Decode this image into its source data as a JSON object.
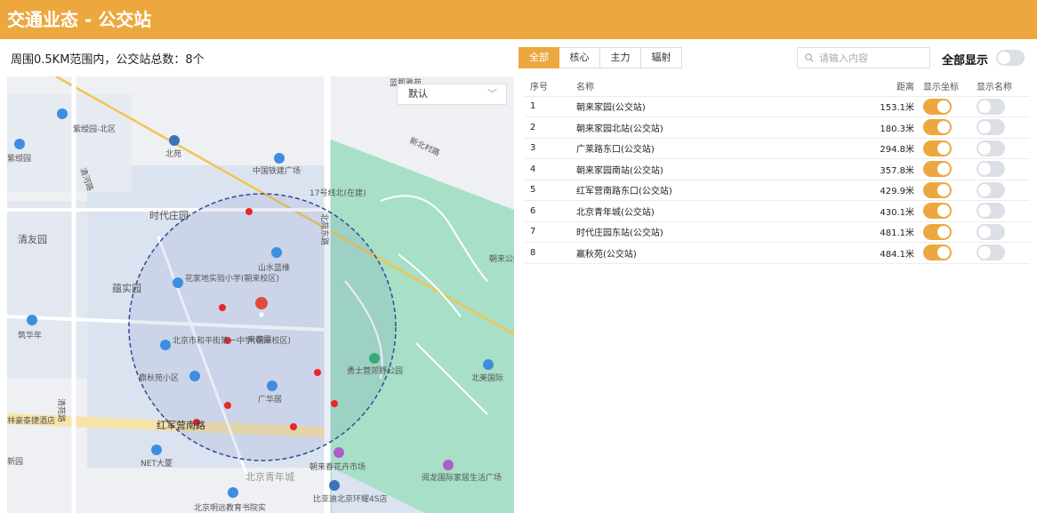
{
  "header": {
    "title": "交通业态 - 公交站"
  },
  "summary": "周围0.5KM范围内，公交站总数：8个",
  "tabs": [
    {
      "label": "全部",
      "active": true
    },
    {
      "label": "核心",
      "active": false
    },
    {
      "label": "主力",
      "active": false
    },
    {
      "label": "辐射",
      "active": false
    }
  ],
  "search": {
    "placeholder": "请输入内容",
    "icon": "search-icon"
  },
  "show_all": {
    "label": "全部显示",
    "on": false
  },
  "map_select": {
    "value": "默认"
  },
  "map": {
    "labels": [
      "蓝郡雅苑",
      "紫绶园-北区",
      "紫绶园",
      "北苑",
      "中国铁建广场",
      "新北村路",
      "清河路",
      "清友园",
      "时代庄园",
      "17号线北(在建)",
      "北苑东路",
      "山水蓝维",
      "蕴实园",
      "花家地实验小学(朝来校区)",
      "朝来公园",
      "筑华年",
      "北京市和平街第一中学(朝来校区)",
      "来春园",
      "鼎秋苑小区",
      "广华居",
      "勇士营郊野公园",
      "北美国际",
      "清苑路",
      "红军营南路",
      "NET大厦",
      "朝来春花卉市场",
      "阅龙国际家居生活广场",
      "北京青年城",
      "北京明远教育书院实",
      "比亚迪北京环耀4S店",
      "林豪泰捷酒店",
      "新园"
    ]
  },
  "table": {
    "headers": {
      "no": "序号",
      "name": "名称",
      "distance": "距离",
      "show_coord": "显示坐标",
      "show_name": "显示名称"
    },
    "rows": [
      {
        "no": "1",
        "name": "朝来家园(公交站)",
        "distance": "153.1米",
        "coord_on": true,
        "name_on": false
      },
      {
        "no": "2",
        "name": "朝来家园北站(公交站)",
        "distance": "180.3米",
        "coord_on": true,
        "name_on": false
      },
      {
        "no": "3",
        "name": "广莱路东口(公交站)",
        "distance": "294.8米",
        "coord_on": true,
        "name_on": false
      },
      {
        "no": "4",
        "name": "朝来家园南站(公交站)",
        "distance": "357.8米",
        "coord_on": true,
        "name_on": false
      },
      {
        "no": "5",
        "name": "红军营南路东口(公交站)",
        "distance": "429.9米",
        "coord_on": true,
        "name_on": false
      },
      {
        "no": "6",
        "name": "北京青年城(公交站)",
        "distance": "430.1米",
        "coord_on": true,
        "name_on": false
      },
      {
        "no": "7",
        "name": "时代庄园东站(公交站)",
        "distance": "481.1米",
        "coord_on": true,
        "name_on": false
      },
      {
        "no": "8",
        "name": "嬴秋苑(公交站)",
        "distance": "484.1米",
        "coord_on": true,
        "name_on": false
      }
    ]
  },
  "colors": {
    "accent": "#eca83f",
    "marker": "#e8262b",
    "park": "#98dcbf",
    "circle": "#2f4b9a"
  }
}
